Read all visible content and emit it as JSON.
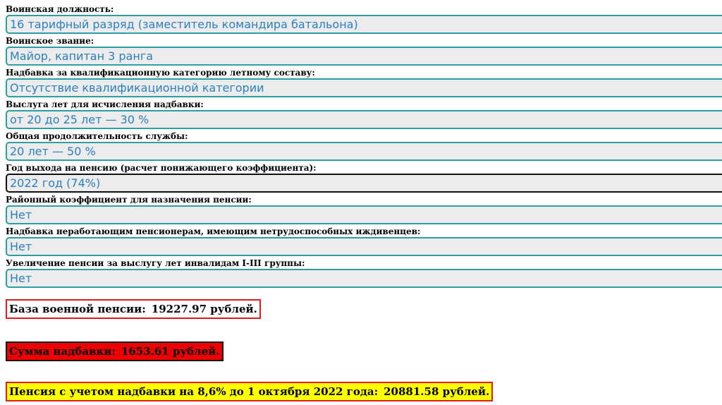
{
  "fields": [
    {
      "label": "Воинская должность:",
      "value": "16 тарифный разряд (заместитель командира батальона)"
    },
    {
      "label": "Воинское звание:",
      "value": "Майор, капитан 3 ранга"
    },
    {
      "label": "Надбавка за квалификационную категорию летному составу:",
      "value": "Отсутствие квалификационной категории"
    },
    {
      "label": "Выслуга лет для исчисления надбавки:",
      "value": "от 20 до 25 лет — 30 %"
    },
    {
      "label": "Общая продолжительность службы:",
      "value": "20 лет — 50 %"
    },
    {
      "label": "Год выхода на пенсию (расчет понижающего коэффициента):",
      "value": "2022 год (74%)"
    },
    {
      "label": "Районный коэффициент для назначения пенсии:",
      "value": "Нет"
    },
    {
      "label": "Надбавка неработающим пенсионерам, имеющим нетрудоспособных иждивенцев:",
      "value": "Нет"
    },
    {
      "label": "Увеличение пенсии за выслугу лет инвалидам I-III группы:",
      "value": "Нет"
    }
  ],
  "results": {
    "base_label": "База военной пенсии:",
    "base_value": "19227.97 рублей.",
    "bonus_label": "Сумма надбавки:",
    "bonus_value": "1653.61 рублей.",
    "total_label": "Пенсия с учетом надбавки на 8,6% до 1 октября 2022 года:",
    "total_value": "20881.58 рублей."
  },
  "colors": {
    "select_border": "#2aa0a4",
    "select_focused_border": "#111111",
    "select_text": "#2a7fc0",
    "select_bg": "#ececec",
    "result_border_red": "#e11d1d",
    "bonus_bg": "#ee0000",
    "total_bg": "#ffff00"
  }
}
